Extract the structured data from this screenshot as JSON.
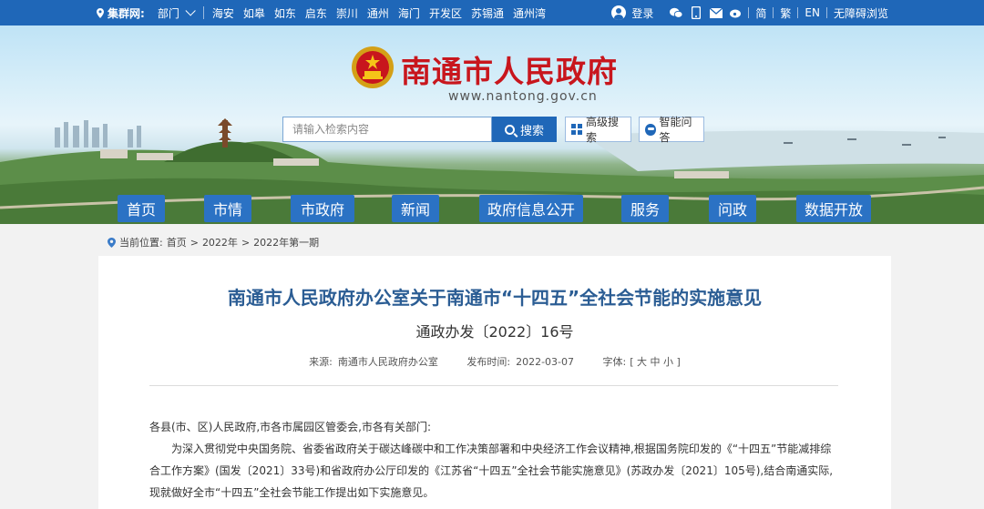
{
  "topbar": {
    "location": "集群网:",
    "dept": "部门",
    "cities": [
      "海安",
      "如皋",
      "如东",
      "启东",
      "崇川",
      "通州",
      "海门",
      "开发区",
      "苏锡通",
      "通州湾"
    ],
    "login": "登录",
    "simplified": "简",
    "traditional": "繁",
    "english": "EN",
    "accessibility": "无障碍浏览"
  },
  "header": {
    "title": "南通市人民政府",
    "url": "www.nantong.gov.cn"
  },
  "search": {
    "placeholder": "请输入检索内容",
    "button": "搜索",
    "advanced": "高级搜索",
    "ai": "智能问答"
  },
  "nav": {
    "items": [
      "首页",
      "市情",
      "市政府",
      "新闻",
      "政府信息公开",
      "服务",
      "问政",
      "数据开放"
    ]
  },
  "breadcrumb": {
    "label": "当前位置:",
    "items": [
      "首页",
      "2022年",
      "2022年第一期"
    ],
    "sep": ">"
  },
  "article": {
    "title": "南通市人民政府办公室关于南通市“十四五”全社会节能的实施意见",
    "doc_number": "通政办发〔2022〕16号",
    "source_label": "来源:",
    "source": "南通市人民政府办公室",
    "date_label": "发布时间:",
    "date": "2022-03-07",
    "font_label": "字体:",
    "font_sizes": "[ 大 中 小 ]",
    "salutation": "各县(市、区)人民政府,市各市属园区管委会,市各有关部门:",
    "paragraph": "为深入贯彻党中央国务院、省委省政府关于碳达峰碳中和工作决策部署和中央经济工作会议精神,根据国务院印发的《“十四五”节能减排综合工作方案》(国发〔2021〕33号)和省政府办公厅印发的《江苏省“十四五”全社会节能实施意见》(苏政办发〔2021〕105号),结合南通实际,现就做好全市“十四五”全社会节能工作提出如下实施意见。"
  },
  "colors": {
    "topbar": "#1f67b8",
    "nav": "#2b72c4",
    "title_red": "#c8161d",
    "article_title": "#2b5d94"
  }
}
